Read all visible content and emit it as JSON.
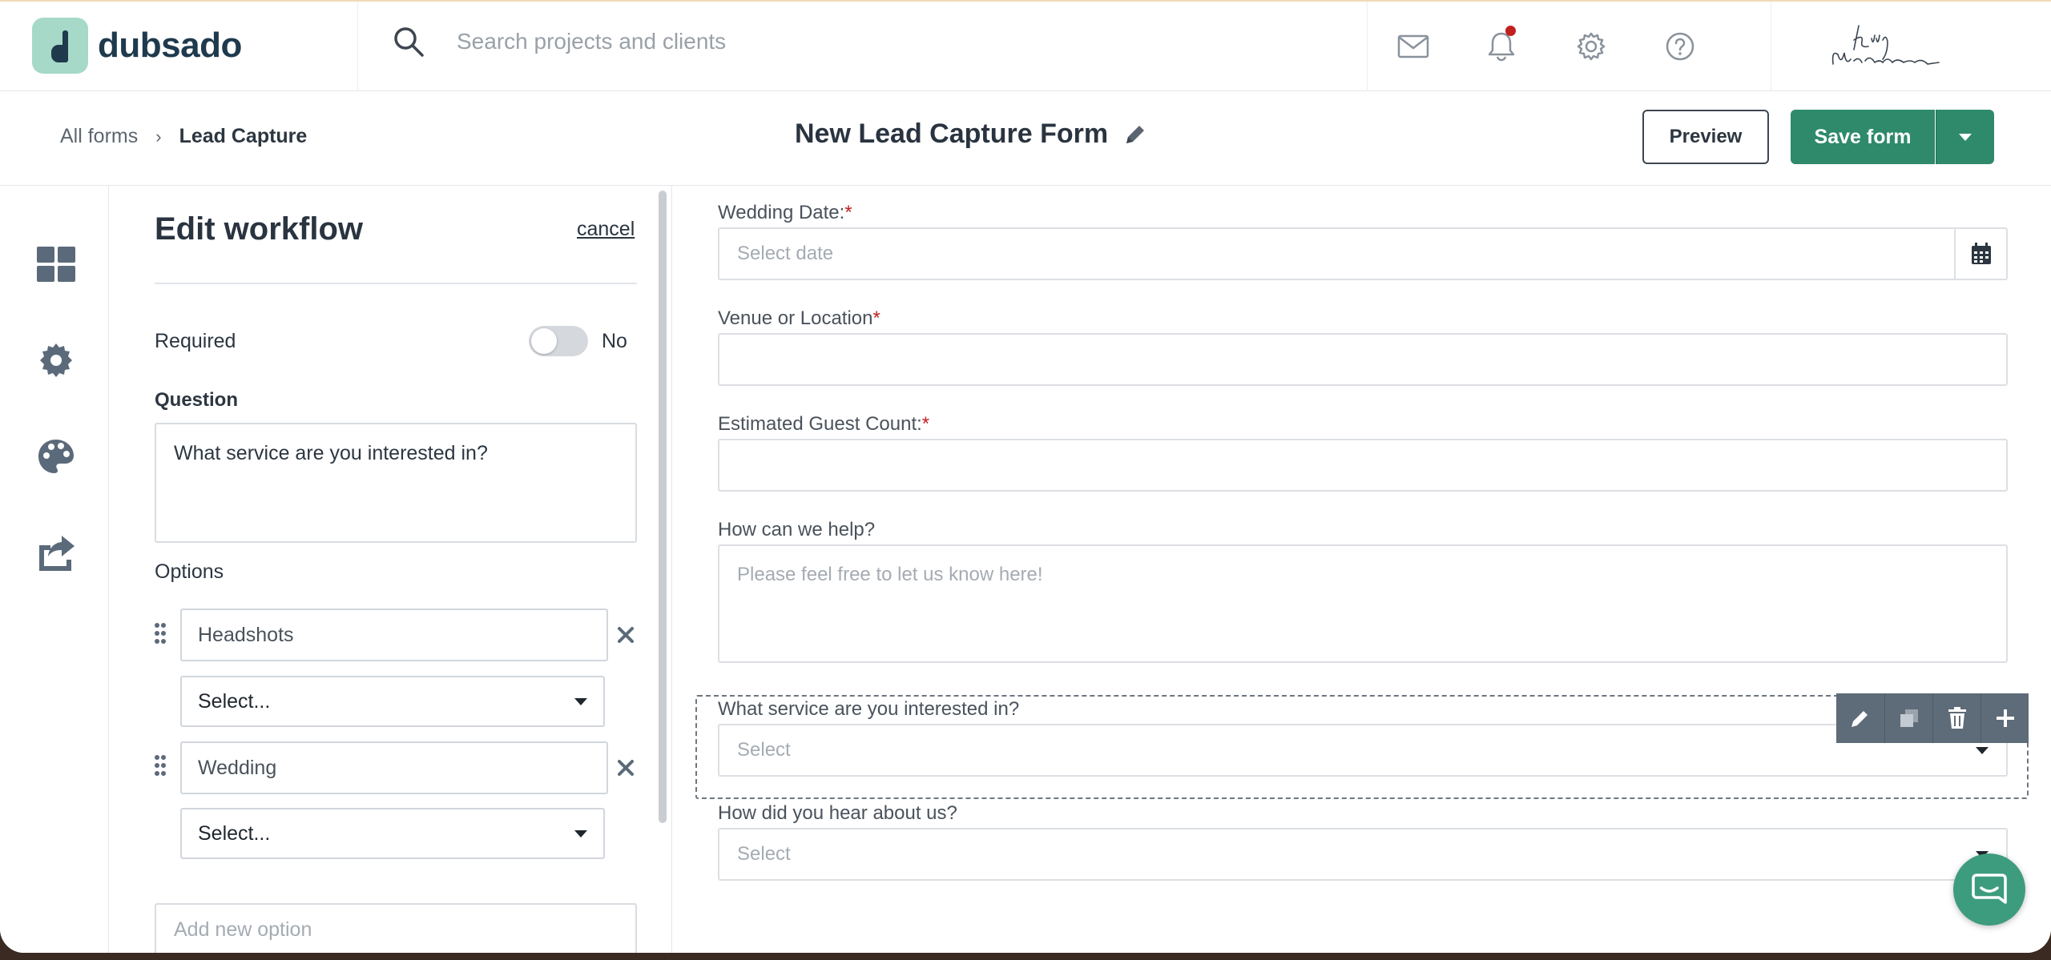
{
  "header": {
    "logo_text": "dubsado",
    "search_placeholder": "Search projects and clients",
    "icons": [
      "mail-icon",
      "bell-icon",
      "gear-icon",
      "help-icon"
    ],
    "notification_dot_color": "#c0201e"
  },
  "subheader": {
    "breadcrumb_root": "All forms",
    "breadcrumb_sep": "›",
    "breadcrumb_current": "Lead Capture",
    "form_title": "New Lead Capture Form",
    "preview_label": "Preview",
    "save_label": "Save form"
  },
  "leftnav": {
    "icons": [
      "dashboard-icon",
      "settings-icon",
      "palette-icon",
      "share-icon"
    ]
  },
  "edit_panel": {
    "title": "Edit workflow",
    "cancel": "cancel",
    "required_label": "Required",
    "required_value": "No",
    "question_label": "Question",
    "question_value": "What service are you interested in?",
    "options_label": "Options",
    "options": [
      {
        "label": "Headshots",
        "workflow": "Select..."
      },
      {
        "label": "Wedding",
        "workflow": "Select..."
      }
    ],
    "add_option_placeholder": "Add new option"
  },
  "form": {
    "fields": [
      {
        "label": "Wedding Date:",
        "required": "*",
        "placeholder": "Select date"
      },
      {
        "label": "Venue or Location",
        "required": "*",
        "placeholder": ""
      },
      {
        "label": "Estimated Guest Count:",
        "required": "*",
        "placeholder": ""
      },
      {
        "label": "How can we help?",
        "placeholder": "Please feel free to let us know here!"
      },
      {
        "label": "What service are you interested in?",
        "placeholder": "Select"
      },
      {
        "label": "How did you hear about us?",
        "placeholder": "Select"
      }
    ],
    "toolbar_icons": [
      "edit-icon",
      "duplicate-icon",
      "trash-icon",
      "add-icon"
    ]
  },
  "colors": {
    "brand_green": "#2e8a6a",
    "logo_mint": "#a6d9c7",
    "navy": "#1f3a4d"
  }
}
